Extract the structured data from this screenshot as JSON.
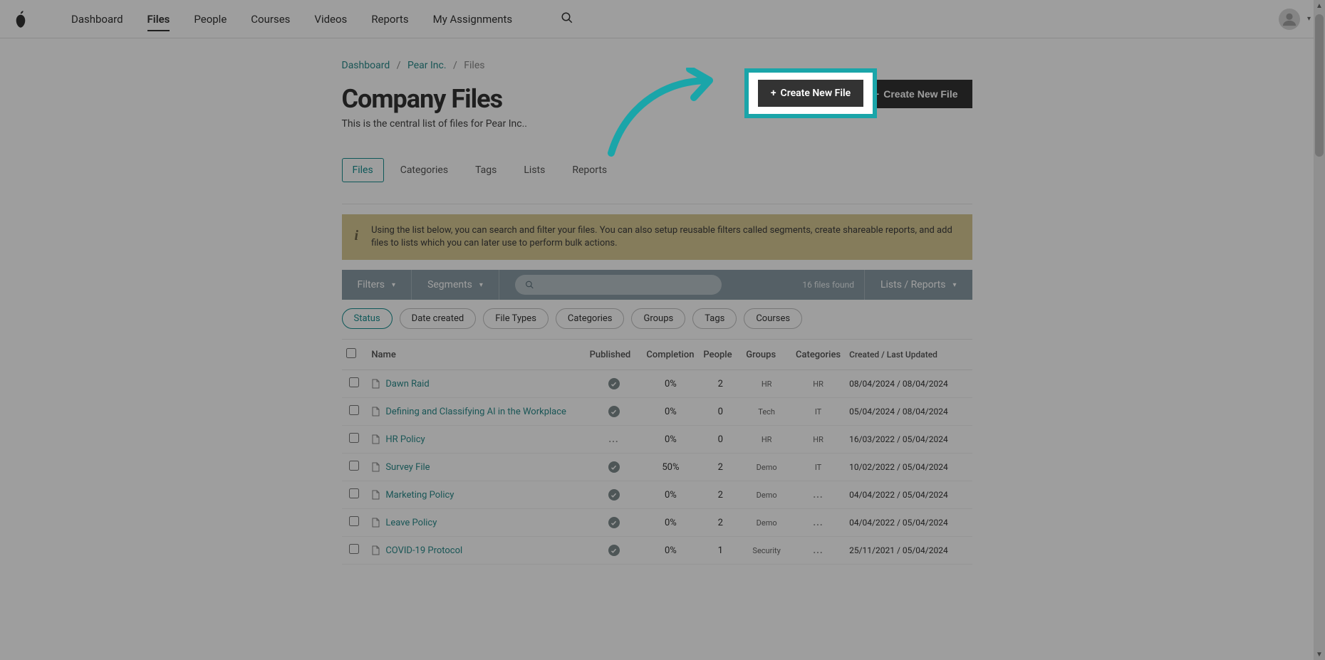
{
  "nav": {
    "items": [
      "Dashboard",
      "Files",
      "People",
      "Courses",
      "Videos",
      "Reports",
      "My Assignments"
    ],
    "active_index": 1
  },
  "breadcrumb": {
    "items": [
      "Dashboard",
      "Pear Inc.",
      "Files"
    ]
  },
  "header": {
    "title": "Company Files",
    "subtitle": "This is the central list of files for Pear Inc..",
    "create_button": "Create New File"
  },
  "subtabs": {
    "items": [
      "Files",
      "Categories",
      "Tags",
      "Lists",
      "Reports"
    ],
    "active_index": 0
  },
  "info_banner": "Using the list below, you can search and filter your files. You can also setup reusable filters called segments, create shareable reports, and add files to lists which you can later use to perform bulk actions.",
  "filter_toolbar": {
    "filters": "Filters",
    "segments": "Segments",
    "count": "16 files found",
    "lists_reports": "Lists / Reports"
  },
  "pills": {
    "items": [
      "Status",
      "Date created",
      "File Types",
      "Categories",
      "Groups",
      "Tags",
      "Courses"
    ],
    "active_index": 0
  },
  "table": {
    "headers": {
      "name": "Name",
      "published": "Published",
      "completion": "Completion",
      "people": "People",
      "groups": "Groups",
      "categories": "Categories",
      "created": "Created / Last Updated"
    },
    "rows": [
      {
        "name": "Dawn Raid",
        "published": "check",
        "completion": "0%",
        "people": "2",
        "groups": "HR",
        "categories": "HR",
        "dates": "08/04/2024 / 08/04/2024"
      },
      {
        "name": "Defining and Classifying AI in the Workplace",
        "published": "check",
        "completion": "0%",
        "people": "0",
        "groups": "Tech",
        "categories": "IT",
        "dates": "05/04/2024 / 08/04/2024"
      },
      {
        "name": "HR Policy",
        "published": "ellipsis",
        "completion": "0%",
        "people": "0",
        "groups": "HR",
        "categories": "HR",
        "dates": "16/03/2022 / 05/04/2024"
      },
      {
        "name": "Survey File",
        "published": "check",
        "completion": "50%",
        "people": "2",
        "groups": "Demo",
        "categories": "IT",
        "dates": "10/02/2022 / 05/04/2024"
      },
      {
        "name": "Marketing Policy",
        "published": "check",
        "completion": "0%",
        "people": "2",
        "groups": "Demo",
        "categories": "...",
        "dates": "04/04/2022 / 05/04/2024"
      },
      {
        "name": "Leave Policy",
        "published": "check",
        "completion": "0%",
        "people": "2",
        "groups": "Demo",
        "categories": "...",
        "dates": "04/04/2022 / 05/04/2024"
      },
      {
        "name": "COVID-19 Protocol",
        "published": "check",
        "completion": "0%",
        "people": "1",
        "groups": "Security",
        "categories": "...",
        "dates": "25/11/2021 / 05/04/2024"
      }
    ]
  },
  "accent_color": "#1aa5a9"
}
